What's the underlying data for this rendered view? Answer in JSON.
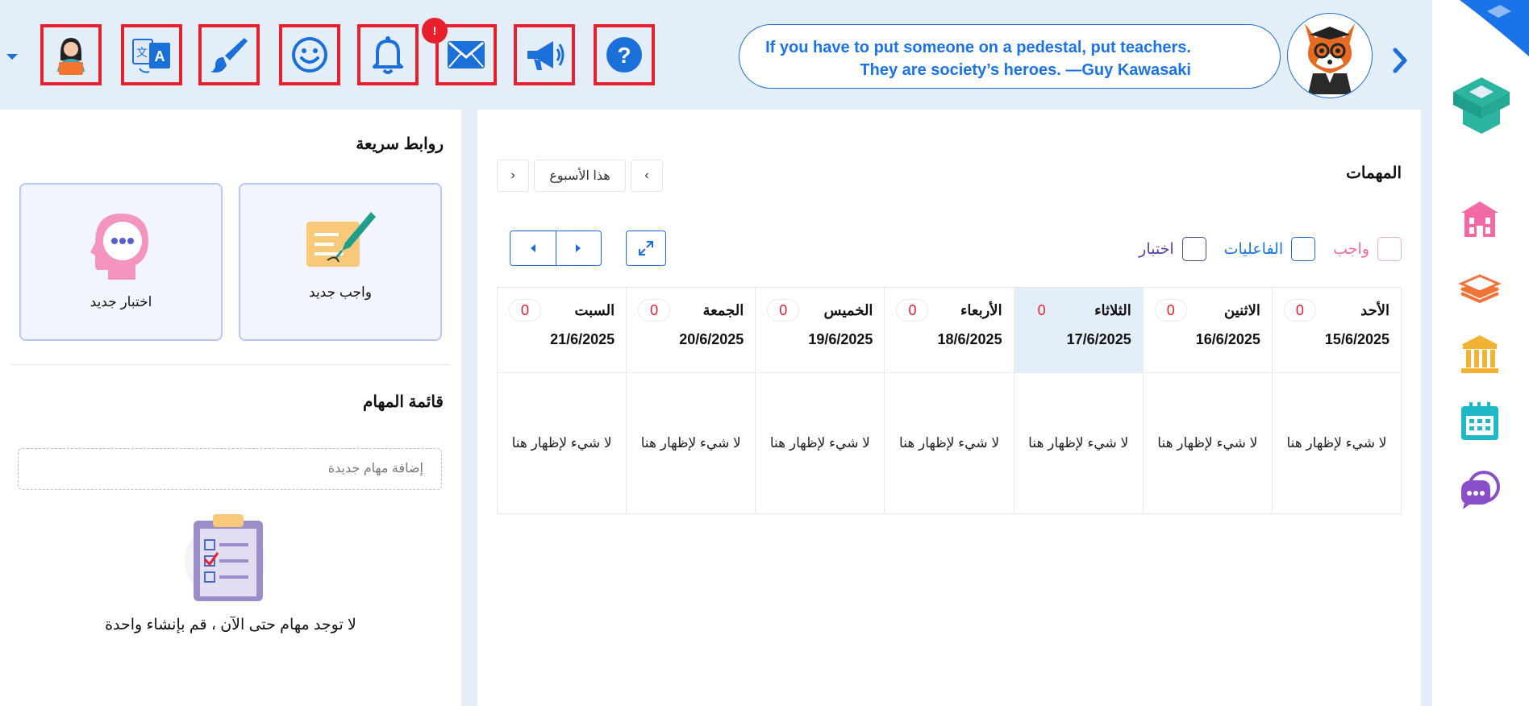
{
  "topbar": {
    "buttons": [
      "profile-icon",
      "translate-icon",
      "brush-icon",
      "smiley-icon",
      "bell-icon",
      "mail-icon",
      "megaphone-icon",
      "help-icon"
    ],
    "mail_badge": "!",
    "quote": "If you have to put someone on a pedestal, put teachers. They are society’s heroes. —Guy Kawasaki"
  },
  "sidebar": {
    "icons": [
      "school-icon",
      "books-icon",
      "institution-icon",
      "calendar-icon",
      "chat-icon"
    ]
  },
  "tasks": {
    "title": "المهمات",
    "week_label": "هذا الأسبوع",
    "legend": [
      {
        "label": "واجب",
        "color": "#f26aa5"
      },
      {
        "label": "الفاعليات",
        "color": "#1a73e8"
      },
      {
        "label": "اختبار",
        "color": "#5a3ea8"
      }
    ],
    "days": [
      {
        "name": "الأحد",
        "date": "15/6/2025",
        "count": "0",
        "empty": "لا شيء لإظهار هنا"
      },
      {
        "name": "الاثنين",
        "date": "16/6/2025",
        "count": "0",
        "empty": "لا شيء لإظهار هنا"
      },
      {
        "name": "الثلاثاء",
        "date": "17/6/2025",
        "count": "0",
        "empty": "لا شيء لإظهار هنا"
      },
      {
        "name": "الأربعاء",
        "date": "18/6/2025",
        "count": "0",
        "empty": "لا شيء لإظهار هنا"
      },
      {
        "name": "الخميس",
        "date": "19/6/2025",
        "count": "0",
        "empty": "لا شيء لإظهار هنا"
      },
      {
        "name": "الجمعة",
        "date": "20/6/2025",
        "count": "0",
        "empty": "لا شيء لإظهار هنا"
      },
      {
        "name": "السبت",
        "date": "21/6/2025",
        "count": "0",
        "empty": "لا شيء لإظهار هنا"
      }
    ]
  },
  "quick_links": {
    "title": "روابط سريعة",
    "new_homework": "واجب جديد",
    "new_exam": "اختبار جديد"
  },
  "todo": {
    "title": "قائمة المهام",
    "placeholder": "إضافة مهام جديدة",
    "empty": "لا توجد مهام حتى الآن ، قم بإنشاء واحدة"
  }
}
